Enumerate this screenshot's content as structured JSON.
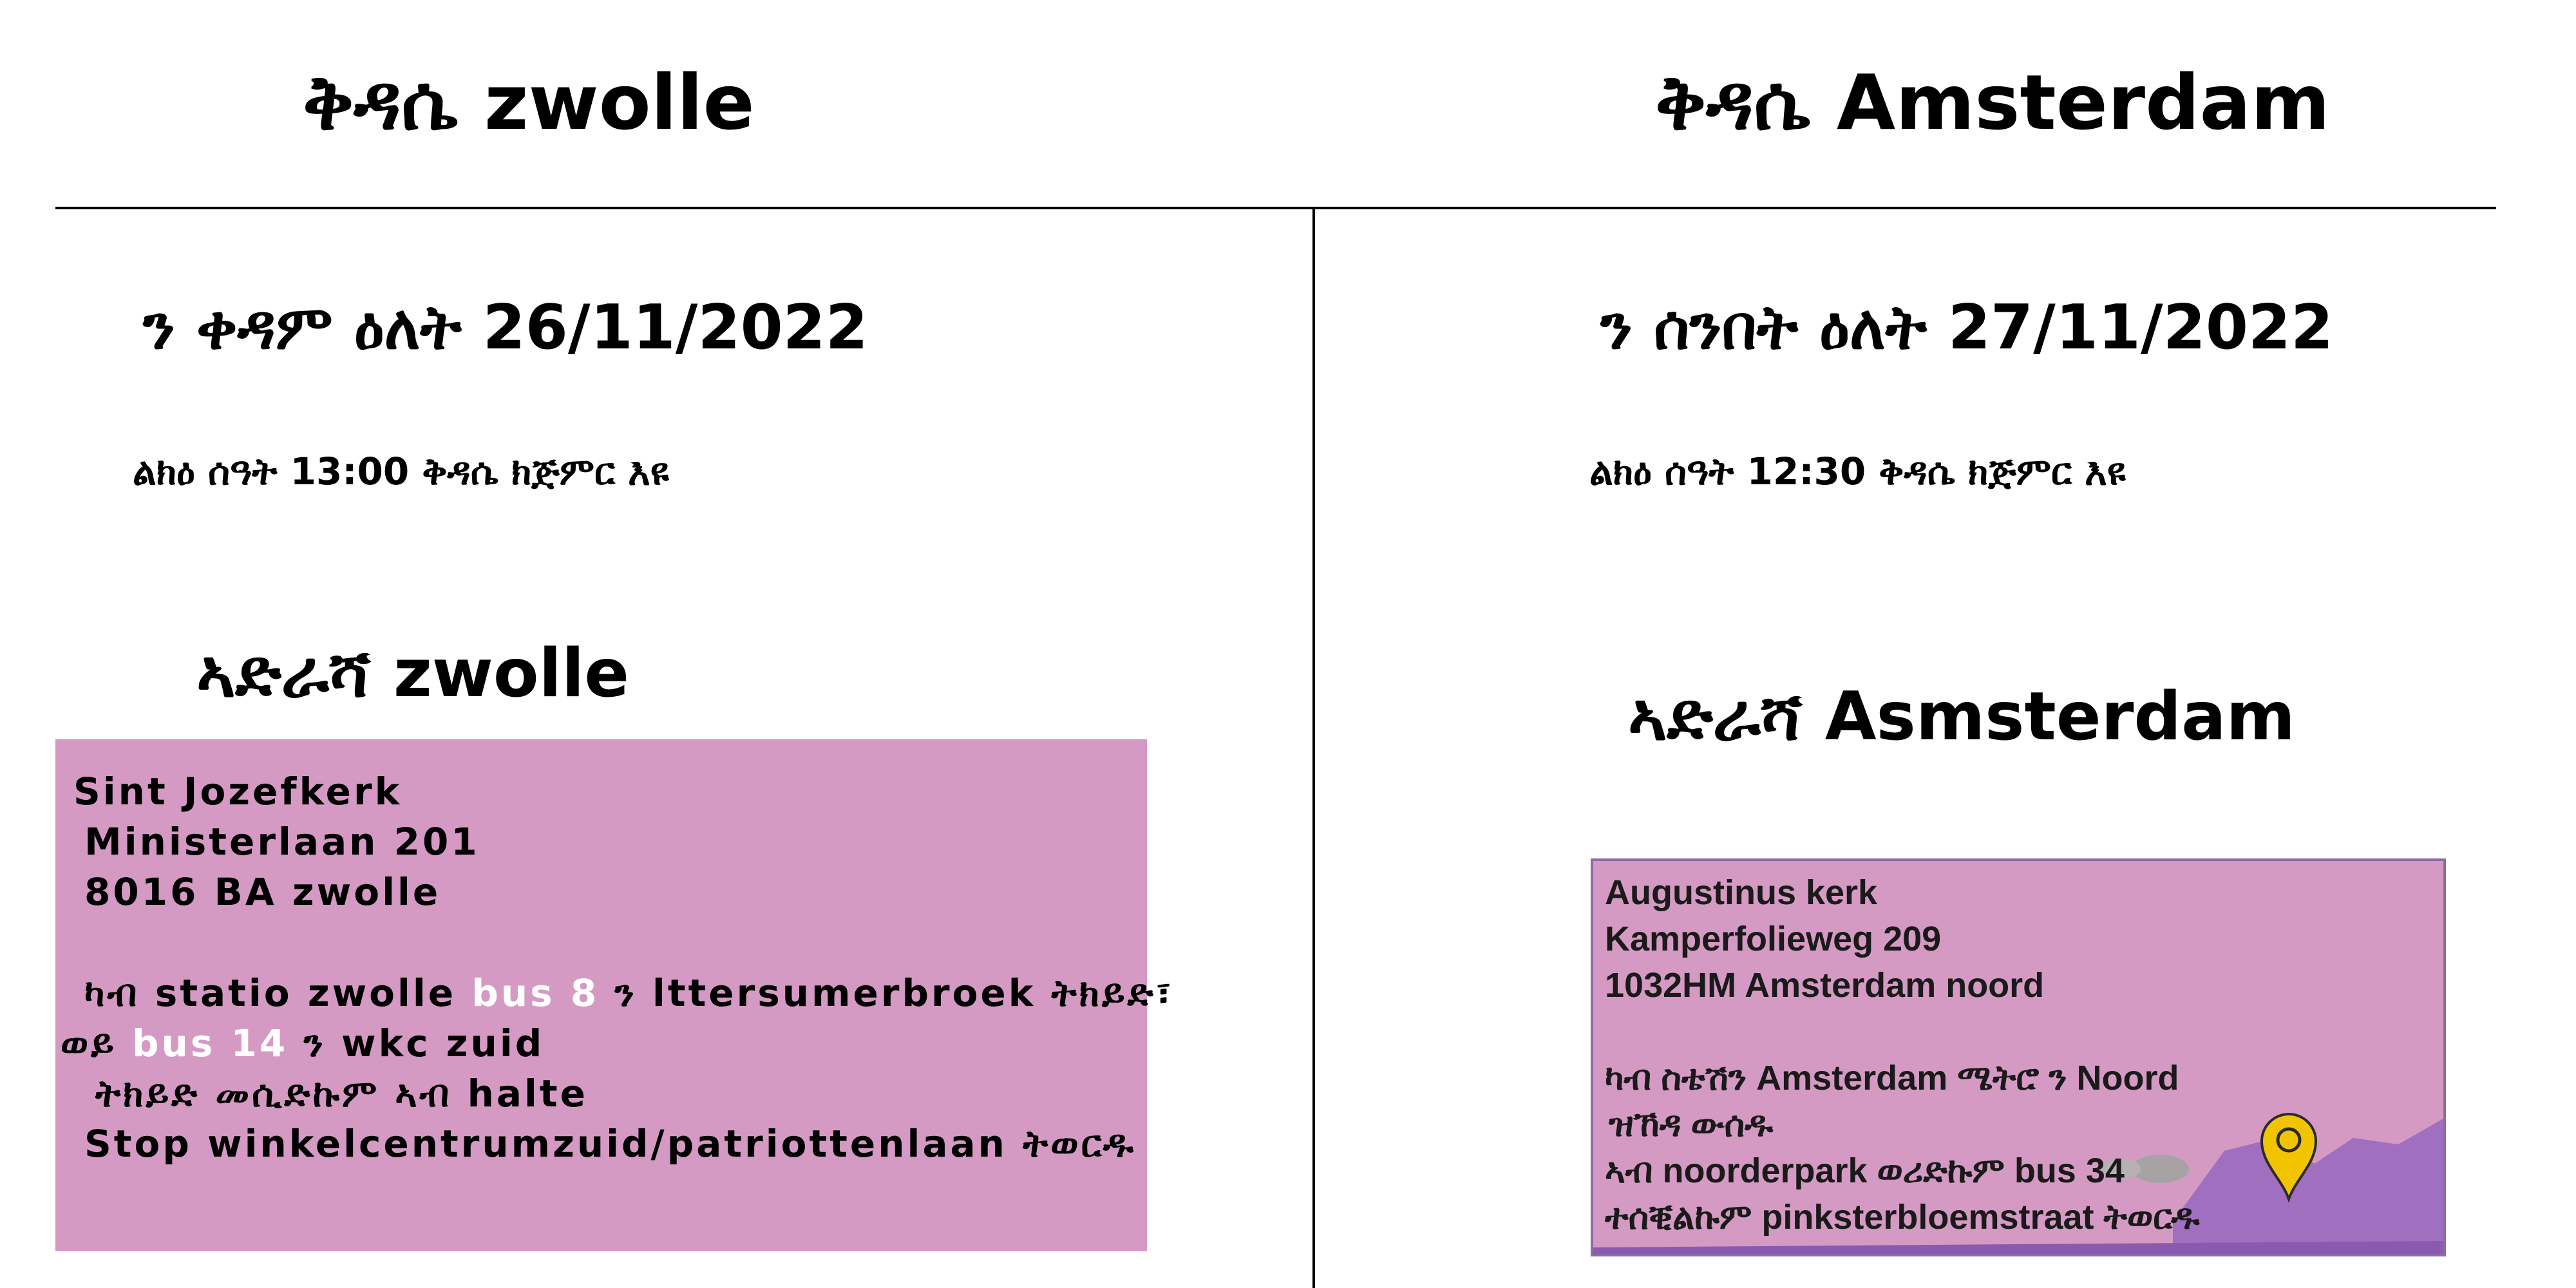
{
  "left": {
    "title": "ቅዳሴ zwolle",
    "date": "ን ቀዳም  ዕለት 26/11/2022",
    "time": "ልክዕ  ሰዓት 13:00 ቅዳሴ  ክጅምር እዩ",
    "address_heading": "ኣድራሻ zwolle",
    "address": {
      "line1": "Sint Jozefkerk",
      "line2": "Ministerlaan 201",
      "line3": "8016 BA zwolle",
      "line4_pre": "ካብ statio zwolle ",
      "line4_bus": "bus 8",
      "line4_post": " ን lttersumerbroek ትክይድ፣",
      "line5_pre": "ወይ ",
      "line5_bus": "bus 14",
      "line5_post": " ን wkc zuid",
      "line6": "ትክይድ መሲድኩም ኣብ halte",
      "line7": "Stop winkelcentrumzuid/patriottenlaan ትወርዱ"
    }
  },
  "right": {
    "title": "ቅዳሴ Amsterdam",
    "date": "ን ሰንበት ዕለት 27/11/2022",
    "time": "ልክዕ  ሰዓት 12:30 ቅዳሴ  ክጅምር እዩ",
    "address_heading": "ኣድራሻ Asmsterdam",
    "address": {
      "line1": "Augustinus kerk",
      "line2": "Kamperfolieweg 209",
      "line3": "1032HM Amsterdam noord",
      "line4": "ካብ ስቴሽን Amsterdam ሜትሮ ን Noord",
      "line5": "ዝኸዳ ውሰዱ",
      "line6": "ኣብ noorderpark ወሪድኩም  bus 34",
      "line7": "ተሰቒልኩም pinksterbloemstraat ትወርዱ"
    }
  },
  "colors": {
    "box_fill": "#d59ac3",
    "map_purple": "#a06fc0",
    "pin": "#f2c400",
    "highlight_text": "#ffffff"
  },
  "icons": {
    "map_pin": "location-pin-icon"
  }
}
